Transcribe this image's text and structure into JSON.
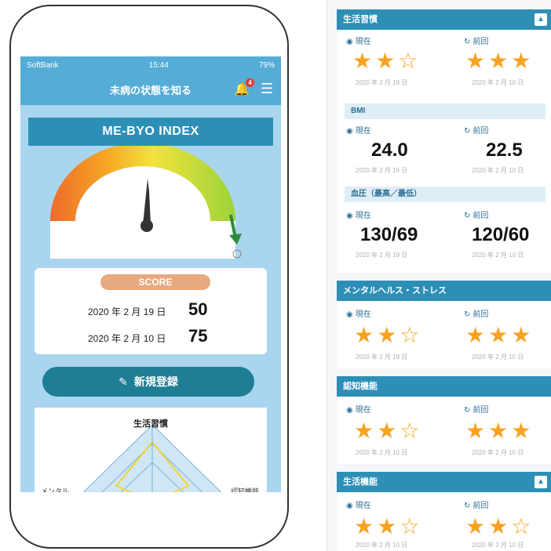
{
  "phone": {
    "status": {
      "carrier": "SoftBank",
      "time": "15:44",
      "battery": "79%"
    },
    "nav": {
      "title": "未病の状態を知る",
      "badge": "4"
    },
    "index_title": "ME-BYO INDEX",
    "score": {
      "label": "SCORE",
      "rows": [
        {
          "date": "2020 年 2 月 19 日",
          "value": "50"
        },
        {
          "date": "2020 年 2 月 10 日",
          "value": "75"
        }
      ]
    },
    "new_button": "新規登録",
    "radar": {
      "title": "生活習慣",
      "left": "メンタル",
      "right": "認知機能"
    }
  },
  "panel": {
    "colors": {
      "accent": "#2d8fb6",
      "star": "#f6a322"
    },
    "labels": {
      "current": "現在",
      "previous": "前回"
    },
    "lifestyle": {
      "title": "生活習慣",
      "current_stars": 2,
      "previous_stars": 3,
      "current_date": "2020 年 2 月 19 日",
      "previous_date": "2020 年 2 月 10 日"
    },
    "bmi": {
      "title": "BMI",
      "current": "24.0",
      "previous": "22.5",
      "current_date": "2020 年 2 月 19 日",
      "previous_date": "2020 年 2 月 10 日"
    },
    "bp": {
      "title": "血圧（最高／最低）",
      "current": "130/69",
      "previous": "120/60",
      "current_date": "2020 年 2 月 19 日",
      "previous_date": "2020 年 2 月 10 日"
    },
    "mental": {
      "title": "メンタルヘルス・ストレス",
      "current_stars": 2,
      "previous_stars": 3,
      "current_date": "2020 年 2 月 19 日",
      "previous_date": "2020 年 2 月 10 日"
    },
    "cognitive": {
      "title": "認知機能",
      "current_stars": 2,
      "previous_stars": 3,
      "current_date": "2020 年 2 月 10 日",
      "previous_date": "2020 年 2 月 10 日"
    },
    "life_function": {
      "title": "生活機能",
      "current_stars": 2,
      "previous_stars": 2,
      "current_date": "2020 年 2 月 10 日",
      "previous_date": "2020 年 2 月 10 日"
    }
  }
}
